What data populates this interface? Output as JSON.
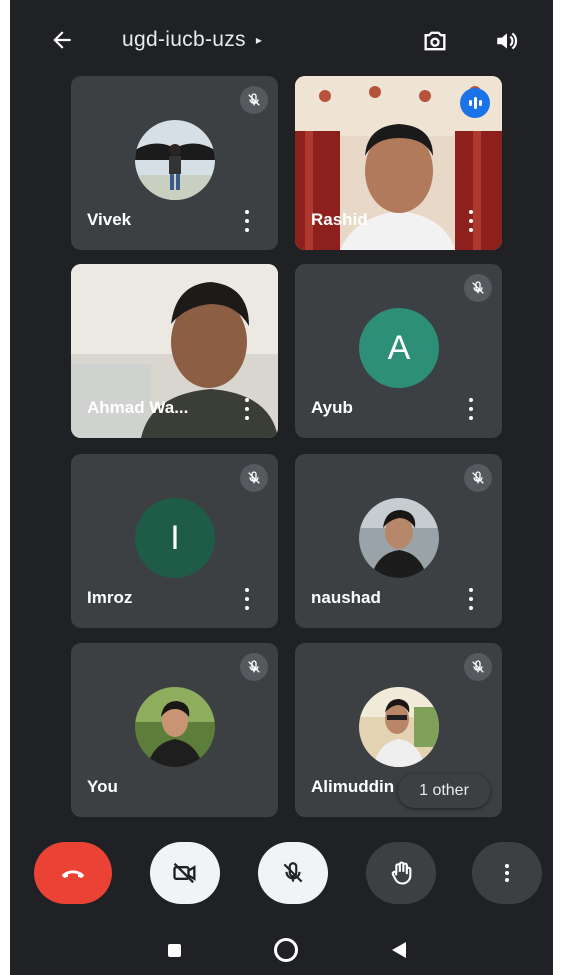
{
  "header": {
    "meeting_code": "ugd-iucb-uzs",
    "caret": "▸"
  },
  "participants": [
    {
      "name": "Vivek",
      "type": "photo-avatar",
      "muted": true
    },
    {
      "name": "Rashid",
      "type": "video",
      "muted": false,
      "speaking": true
    },
    {
      "name": "Ahmad Wa...",
      "type": "video",
      "muted": false
    },
    {
      "name": "Ayub",
      "type": "letter",
      "letter": "A",
      "color": "#2d8f76",
      "muted": true
    },
    {
      "name": "Imroz",
      "type": "letter",
      "letter": "I",
      "color": "#1f5c47",
      "muted": true
    },
    {
      "name": "naushad",
      "type": "photo-avatar",
      "muted": true
    },
    {
      "name": "You",
      "type": "photo-avatar",
      "muted": true
    },
    {
      "name": "Alimuddin",
      "type": "photo-avatar",
      "muted": true
    }
  ],
  "others_chip": "1 other",
  "controls": [
    "end-call",
    "camera-off",
    "mic-off",
    "raise-hand",
    "more-options"
  ],
  "colors": {
    "background": "#202124",
    "tile": "#3c4043",
    "end_call": "#ea4335",
    "speaking_indicator": "#1a73e8"
  }
}
